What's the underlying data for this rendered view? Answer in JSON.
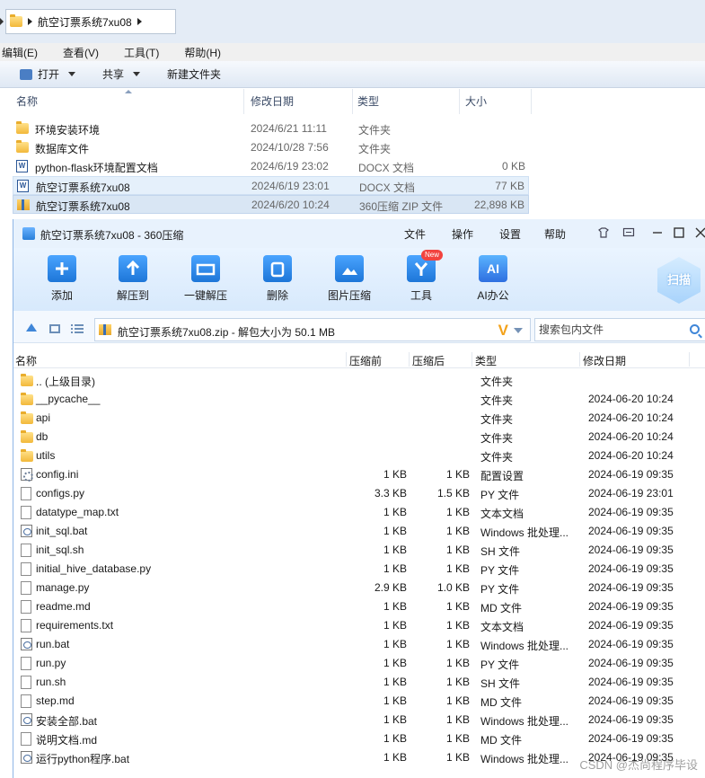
{
  "explorer": {
    "address": "航空订票系统7xu08",
    "menu": [
      "编辑(E)",
      "查看(V)",
      "工具(T)",
      "帮助(H)"
    ],
    "toolbar": {
      "open": "打开",
      "share": "共享",
      "new_folder": "新建文件夹"
    },
    "columns": {
      "name": "名称",
      "modified": "修改日期",
      "type": "类型",
      "size": "大小"
    },
    "rows": [
      {
        "icon": "folder-icon",
        "name": "环境安装环境",
        "modified": "2024/6/21 11:11",
        "type": "文件夹",
        "size": ""
      },
      {
        "icon": "folder-icon",
        "name": "数据库文件",
        "modified": "2024/10/28 7:56",
        "type": "文件夹",
        "size": ""
      },
      {
        "icon": "word-doc-icon",
        "name": "python-flask环境配置文档",
        "modified": "2024/6/19 23:02",
        "type": "DOCX 文档",
        "size": "0 KB"
      },
      {
        "icon": "word-doc-icon",
        "name": "航空订票系统7xu08",
        "modified": "2024/6/19 23:01",
        "type": "DOCX 文档",
        "size": "77 KB"
      },
      {
        "icon": "zip-archive-icon",
        "name": "航空订票系统7xu08",
        "modified": "2024/6/20 10:24",
        "type": "360压缩 ZIP 文件",
        "size": "22,898 KB"
      }
    ]
  },
  "zip": {
    "title": "航空订票系统7xu08 - 360压缩",
    "menu": [
      "文件",
      "操作",
      "设置",
      "帮助"
    ],
    "tools": [
      {
        "label": "添加",
        "icon": "add-icon"
      },
      {
        "label": "解压到",
        "icon": "extract-to-icon"
      },
      {
        "label": "一键解压",
        "icon": "one-click-extract-icon"
      },
      {
        "label": "删除",
        "icon": "delete-icon"
      },
      {
        "label": "图片压缩",
        "icon": "image-compress-icon"
      },
      {
        "label": "工具",
        "icon": "tools-icon",
        "badge": "New"
      },
      {
        "label": "AI办公",
        "icon": "ai-office-icon",
        "icon_text": "AI"
      }
    ],
    "scan_label": "扫描",
    "path_text": "航空订票系统7xu08.zip - 解包大小为 50.1 MB",
    "v_badge": "V",
    "search_placeholder": "搜索包内文件",
    "columns": {
      "name": "名称",
      "before": "压缩前",
      "after": "压缩后",
      "type": "类型",
      "modified": "修改日期"
    },
    "rows": [
      {
        "icon": "folder-icon",
        "name": ".. (上级目录)",
        "before": "",
        "after": "",
        "type": "文件夹",
        "modified": ""
      },
      {
        "icon": "folder-icon",
        "name": "__pycache__",
        "before": "",
        "after": "",
        "type": "文件夹",
        "modified": "2024-06-20 10:24"
      },
      {
        "icon": "folder-icon",
        "name": "api",
        "before": "",
        "after": "",
        "type": "文件夹",
        "modified": "2024-06-20 10:24"
      },
      {
        "icon": "folder-icon",
        "name": "db",
        "before": "",
        "after": "",
        "type": "文件夹",
        "modified": "2024-06-20 10:24"
      },
      {
        "icon": "folder-icon",
        "name": "utils",
        "before": "",
        "after": "",
        "type": "文件夹",
        "modified": "2024-06-20 10:24"
      },
      {
        "icon": "config-file-icon",
        "name": "config.ini",
        "before": "1 KB",
        "after": "1 KB",
        "type": "配置设置",
        "modified": "2024-06-19 09:35"
      },
      {
        "icon": "file-icon",
        "name": "configs.py",
        "before": "3.3 KB",
        "after": "1.5 KB",
        "type": "PY 文件",
        "modified": "2024-06-19 23:01"
      },
      {
        "icon": "file-icon",
        "name": "datatype_map.txt",
        "before": "1 KB",
        "after": "1 KB",
        "type": "文本文档",
        "modified": "2024-06-19 09:35"
      },
      {
        "icon": "batch-file-icon",
        "name": "init_sql.bat",
        "before": "1 KB",
        "after": "1 KB",
        "type": "Windows 批处理...",
        "modified": "2024-06-19 09:35"
      },
      {
        "icon": "file-icon",
        "name": "init_sql.sh",
        "before": "1 KB",
        "after": "1 KB",
        "type": "SH 文件",
        "modified": "2024-06-19 09:35"
      },
      {
        "icon": "file-icon",
        "name": "initial_hive_database.py",
        "before": "1 KB",
        "after": "1 KB",
        "type": "PY 文件",
        "modified": "2024-06-19 09:35"
      },
      {
        "icon": "file-icon",
        "name": "manage.py",
        "before": "2.9 KB",
        "after": "1.0 KB",
        "type": "PY 文件",
        "modified": "2024-06-19 09:35"
      },
      {
        "icon": "file-icon",
        "name": "readme.md",
        "before": "1 KB",
        "after": "1 KB",
        "type": "MD 文件",
        "modified": "2024-06-19 09:35"
      },
      {
        "icon": "file-icon",
        "name": "requirements.txt",
        "before": "1 KB",
        "after": "1 KB",
        "type": "文本文档",
        "modified": "2024-06-19 09:35"
      },
      {
        "icon": "batch-file-icon",
        "name": "run.bat",
        "before": "1 KB",
        "after": "1 KB",
        "type": "Windows 批处理...",
        "modified": "2024-06-19 09:35"
      },
      {
        "icon": "file-icon",
        "name": "run.py",
        "before": "1 KB",
        "after": "1 KB",
        "type": "PY 文件",
        "modified": "2024-06-19 09:35"
      },
      {
        "icon": "file-icon",
        "name": "run.sh",
        "before": "1 KB",
        "after": "1 KB",
        "type": "SH 文件",
        "modified": "2024-06-19 09:35"
      },
      {
        "icon": "file-icon",
        "name": "step.md",
        "before": "1 KB",
        "after": "1 KB",
        "type": "MD 文件",
        "modified": "2024-06-19 09:35"
      },
      {
        "icon": "batch-file-icon",
        "name": "安装全部.bat",
        "before": "1 KB",
        "after": "1 KB",
        "type": "Windows 批处理...",
        "modified": "2024-06-19 09:35"
      },
      {
        "icon": "file-icon",
        "name": "说明文档.md",
        "before": "1 KB",
        "after": "1 KB",
        "type": "MD 文件",
        "modified": "2024-06-19 09:35"
      },
      {
        "icon": "batch-file-icon",
        "name": "运行python程序.bat",
        "before": "1 KB",
        "after": "1 KB",
        "type": "Windows 批处理...",
        "modified": "2024-06-19 09:35"
      }
    ]
  },
  "watermark": "CSDN @杰尚程序毕设"
}
